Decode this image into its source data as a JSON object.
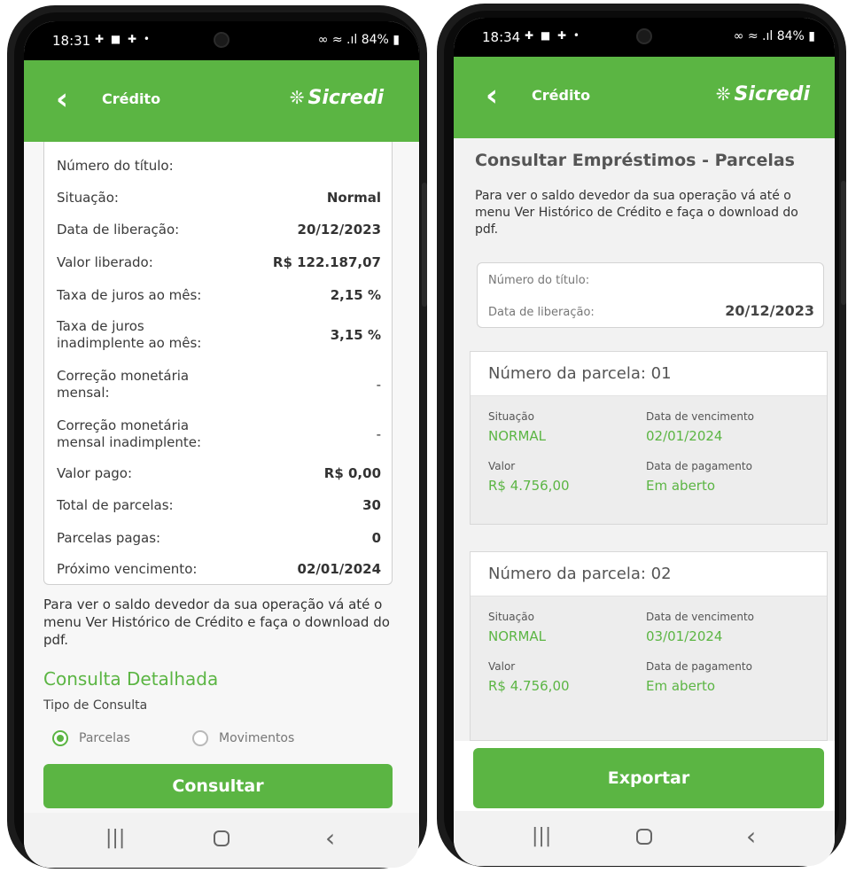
{
  "left": {
    "status": {
      "time": "18:31",
      "notifications": "✚ ■ ✚ •",
      "right": "∞ ≈ .ıl 84% ▮"
    },
    "header": {
      "back": "‹",
      "title": "Crédito",
      "brand_mark": "❊",
      "brand": "Sicredi"
    },
    "details": [
      {
        "label": "Número do título:",
        "value": ""
      },
      {
        "label": "Situação:",
        "value": "Normal"
      },
      {
        "label": "Data de liberação:",
        "value": "20/12/2023"
      },
      {
        "label": "Valor liberado:",
        "value": "R$ 122.187,07"
      },
      {
        "label": "Taxa de juros ao mês:",
        "value": "2,15 %"
      },
      {
        "label": "Taxa de juros",
        "label2": "inadimplente ao mês:",
        "value": "3,15 %"
      },
      {
        "label": "Correção monetária",
        "label2": "mensal:",
        "value": "-"
      },
      {
        "label": "Correção monetária",
        "label2": "mensal inadimplente:",
        "value": "-"
      },
      {
        "label": "Valor pago:",
        "value": "R$ 0,00"
      },
      {
        "label": "Total de parcelas:",
        "value": "30"
      },
      {
        "label": "Parcelas pagas:",
        "value": "0"
      },
      {
        "label": "Próximo vencimento:",
        "value": "02/01/2024"
      }
    ],
    "info_text": "Para ver o saldo devedor da sua operação vá até o menu  Ver Histórico de Crédito e faça o download do pdf.",
    "section_title": "Consulta Detalhada",
    "consult_type_label": "Tipo de Consulta",
    "radio_options": [
      {
        "label": "Parcelas",
        "selected": true
      },
      {
        "label": "Movimentos",
        "selected": false
      }
    ],
    "button": "Consultar",
    "nav": {
      "recent": "|||",
      "back": "‹"
    }
  },
  "right": {
    "status": {
      "time": "18:34",
      "notifications": "✚ ■ ✚ •",
      "right": "∞ ≈ .ıl 84% ▮"
    },
    "header": {
      "back": "‹",
      "title": "Crédito",
      "brand_mark": "❊",
      "brand": "Sicredi"
    },
    "page_title": "Consultar Empréstimos - Parcelas",
    "info_text": "Para ver o saldo devedor da sua operação vá até o menu  Ver Histórico de Crédito e faça o download do pdf.",
    "summary": {
      "numero_label": "Número do título:",
      "data_label": "Data de liberação:",
      "data_value": "20/12/2023"
    },
    "installments": [
      {
        "title": "Número da parcela: 01",
        "situacao_label": "Situação",
        "situacao": "NORMAL",
        "vencimento_label": "Data de vencimento",
        "vencimento": "02/01/2024",
        "valor_label": "Valor",
        "valor": "R$ 4.756,00",
        "pagamento_label": "Data de pagamento",
        "pagamento": "Em aberto"
      },
      {
        "title": "Número da parcela: 02",
        "situacao_label": "Situação",
        "situacao": "NORMAL",
        "vencimento_label": "Data de vencimento",
        "vencimento": "03/01/2024",
        "valor_label": "Valor",
        "valor": "R$ 4.756,00",
        "pagamento_label": "Data de pagamento",
        "pagamento": "Em aberto"
      }
    ],
    "button": "Exportar",
    "nav": {
      "recent": "|||",
      "back": "‹"
    }
  },
  "colors": {
    "brand_green": "#5bb543",
    "text": "#333333",
    "muted": "#777777"
  }
}
